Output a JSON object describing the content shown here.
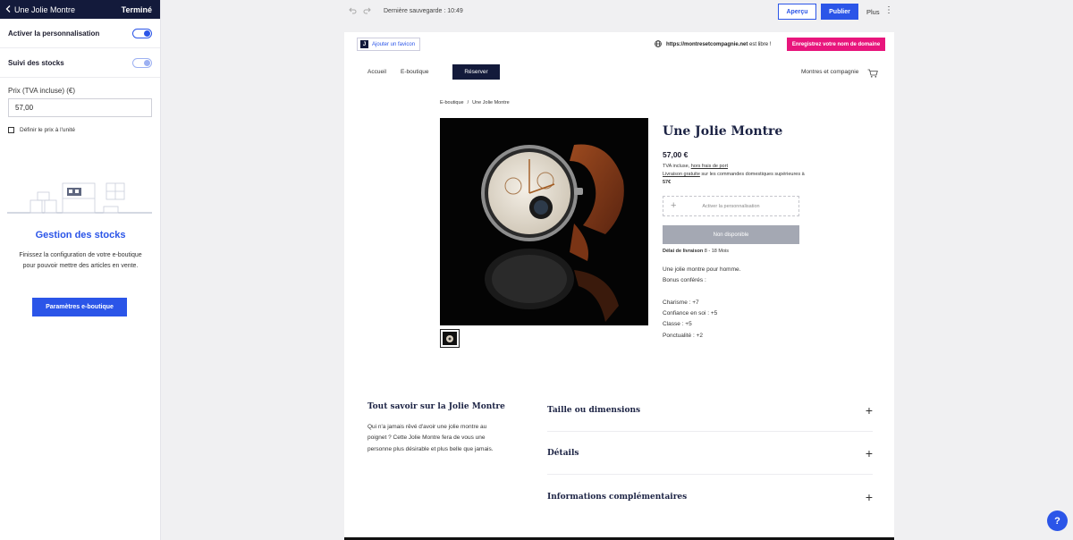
{
  "panel": {
    "title": "Une Jolie Montre",
    "done": "Terminé",
    "toggles": [
      {
        "label": "Activer la personnalisation",
        "on": true
      },
      {
        "label": "Suivi des stocks",
        "on": false
      }
    ],
    "price_label": "Prix (TVA incluse) (€)",
    "price_value": "57,00",
    "unit_price_label": "Définir le prix à l'unité",
    "stock_title": "Gestion des stocks",
    "stock_desc": "Finissez la configuration de votre e-boutique pour pouvoir mettre des articles en vente.",
    "stock_button": "Paramètres e-boutique"
  },
  "topbar": {
    "saved": "Dernière sauvegarde : 10:49",
    "preview": "Aperçu",
    "publish": "Publier",
    "more": "Plus"
  },
  "site": {
    "favicon": "Ajouter un favicon",
    "favicon_letter": "J",
    "domain_name": "https://montresetcompagnie.net",
    "domain_suffix": "est libre !",
    "domain_button": "Enregistrez votre nom de domaine",
    "nav": [
      "Accueil",
      "E-boutique"
    ],
    "reserve": "Réserver",
    "brand": "Montres et compagnie",
    "breadcrumb": [
      "E-boutique",
      "/",
      "Une Jolie Montre"
    ]
  },
  "product": {
    "title": "Une Jolie Montre",
    "price": "57,00 €",
    "tax_line_1": "TVA incluse,",
    "tax_link": "hors frais de port",
    "shipping_link": "Livraison gratuite",
    "shipping_text": "sur les commandes domestiques supérieures à",
    "shipping_threshold": "57€",
    "personalize": "Activer la personnalisation",
    "unavailable": "Non disponible",
    "delay_label": "Délai de livraison",
    "delay_value": "8 - 18 Mois",
    "description": [
      "Une jolie montre pour homme.",
      "Bonus conférés :",
      "",
      "Charisme : +7",
      "Confiance en soi : +5",
      "Classe : +5",
      "Ponctualité : +2"
    ]
  },
  "about": {
    "title": "Tout savoir sur la Jolie Montre",
    "text": "Qui n'a jamais rêvé d'avoir une jolie montre au poignet ? Cette Jolie Montre fera de vous une personne plus désirable et plus belle que jamais."
  },
  "accordion": [
    "Taille ou dimensions",
    "Détails",
    "Informations complémentaires"
  ],
  "help": "?",
  "colors": {
    "accent": "#2b55e8",
    "dark": "#131a3b",
    "pink": "#e8157c"
  }
}
